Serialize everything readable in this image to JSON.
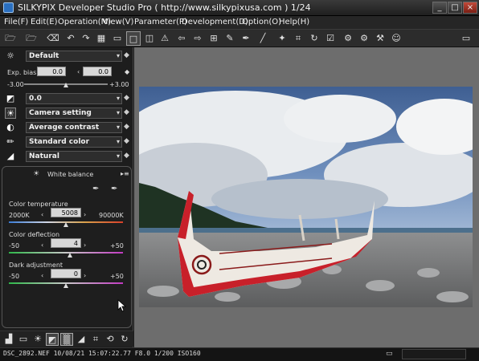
{
  "window": {
    "title": "SILKYPIX Developer Studio Pro ( http://www.silkypixusa.com )   1/24",
    "min_label": "_",
    "max_label": "□",
    "close_label": "×"
  },
  "menu": [
    "File(F)",
    "Edit(E)",
    "Operation(M)",
    "View(V)",
    "Parameter(P)",
    "Development(D)",
    "Option(O)",
    "Help(H)"
  ],
  "toolbar_icons": [
    "open-folder-icon",
    "open-recent-icon",
    "eraser-icon",
    "undo-icon",
    "redo-icon",
    "grid-view-icon",
    "filmstrip-view-icon",
    "single-view-icon",
    "compare-view-icon",
    "warning-icon",
    "rotate-left-icon",
    "rotate-right-icon",
    "grid-icon",
    "dropper-icon",
    "dropper-2-icon",
    "brush-icon",
    "wand-icon",
    "crop-icon",
    "refresh-icon",
    "checkbox-icon",
    "gear-settings-icon",
    "gears-icon",
    "hammer-icon",
    "help-badge-icon",
    "display-icon"
  ],
  "panel": {
    "preset": {
      "label": "Default"
    },
    "exposure_bias": {
      "label": "Exp. bias",
      "value1": "0.0",
      "value2": "0.0",
      "min": "-3.00",
      "max": "+3.00"
    },
    "tone": {
      "label": "0.0"
    },
    "camera": {
      "label": "Camera setting"
    },
    "contrast": {
      "label": "Average contrast"
    },
    "color": {
      "label": "Standard color"
    },
    "sharpness": {
      "label": "Natural"
    },
    "white_balance": {
      "title": "White balance",
      "color_temperature": {
        "label": "Color temperature",
        "value": "5008",
        "min": "2000K",
        "max": "90000K"
      },
      "color_deflection": {
        "label": "Color deflection",
        "value": "4",
        "min": "-50",
        "max": "+50"
      },
      "dark_adjustment": {
        "label": "Dark adjustment",
        "value": "0",
        "min": "-50",
        "max": "+50"
      }
    }
  },
  "status": {
    "text": "DSC_2892.NEF 10/08/21 15:07:22.77 F8.0 1/200 ISO160"
  },
  "colors": {
    "accent": "#2a6fc0",
    "boat_red": "#c8202a",
    "sky": "#4a72a8"
  }
}
